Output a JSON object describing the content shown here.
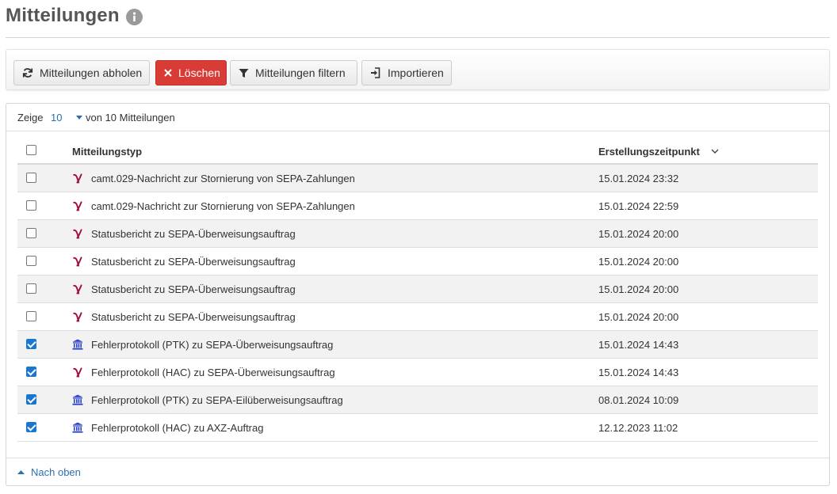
{
  "header": {
    "title": "Mitteilungen",
    "info_icon": "info-icon"
  },
  "toolbar": {
    "fetch_label": "Mitteilungen abholen",
    "delete_label": "Löschen",
    "filter_label": "Mitteilungen filtern",
    "import_label": "Importieren",
    "colors": {
      "danger": "#d93c36",
      "link": "#2a6fb0",
      "checkbox": "#1976d2"
    }
  },
  "pager": {
    "show_label": "Zeige",
    "page_size": "10",
    "total_label": "von 10 Mitteilungen"
  },
  "table": {
    "columns": {
      "type": "Mitteilungstyp",
      "created": "Erstellungszeitpunkt"
    },
    "sort_icon": "chevron-down-icon",
    "rows": [
      {
        "checked": false,
        "icon": "y-logo-icon",
        "type": "camt.029-Nachricht zur Stornierung von SEPA-Zahlungen",
        "date": "15.01.2024 23:32"
      },
      {
        "checked": false,
        "icon": "y-logo-icon",
        "type": "camt.029-Nachricht zur Stornierung von SEPA-Zahlungen",
        "date": "15.01.2024 22:59"
      },
      {
        "checked": false,
        "icon": "y-logo-icon",
        "type": "Statusbericht zu SEPA-Überweisungsauftrag",
        "date": "15.01.2024 20:00"
      },
      {
        "checked": false,
        "icon": "y-logo-icon",
        "type": "Statusbericht zu SEPA-Überweisungsauftrag",
        "date": "15.01.2024 20:00"
      },
      {
        "checked": false,
        "icon": "y-logo-icon",
        "type": "Statusbericht zu SEPA-Überweisungsauftrag",
        "date": "15.01.2024 20:00"
      },
      {
        "checked": false,
        "icon": "y-logo-icon",
        "type": "Statusbericht zu SEPA-Überweisungsauftrag",
        "date": "15.01.2024 20:00"
      },
      {
        "checked": true,
        "icon": "bank-icon",
        "type": "Fehlerprotokoll (PTK) zu SEPA-Überweisungsauftrag",
        "date": "15.01.2024 14:43"
      },
      {
        "checked": true,
        "icon": "y-logo-icon",
        "type": "Fehlerprotokoll (HAC) zu SEPA-Überweisungsauftrag",
        "date": "15.01.2024 14:43"
      },
      {
        "checked": true,
        "icon": "bank-icon",
        "type": "Fehlerprotokoll (PTK) zu SEPA-Eilüberweisungsauftrag",
        "date": "08.01.2024 10:09"
      },
      {
        "checked": true,
        "icon": "bank-icon",
        "type": "Fehlerprotokoll (HAC) zu AXZ-Auftrag",
        "date": "12.12.2023 11:02"
      }
    ]
  },
  "footer": {
    "back_to_top_label": "Nach oben"
  }
}
